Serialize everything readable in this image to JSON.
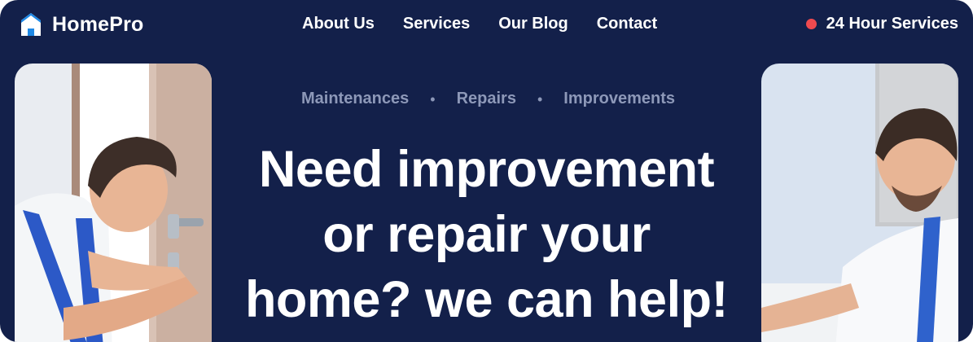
{
  "brand": {
    "name": "HomePro",
    "icon": "house-icon",
    "accent": "#1e88e5"
  },
  "nav": {
    "items": [
      {
        "label": "About Us"
      },
      {
        "label": "Services"
      },
      {
        "label": "Our Blog"
      },
      {
        "label": "Contact"
      }
    ]
  },
  "availability": {
    "label": "24 Hour Services",
    "dot_color": "#ef4a4f"
  },
  "hero": {
    "tags": [
      "Maintenances",
      "Repairs",
      "Improvements"
    ],
    "separator": "•",
    "headline_lines": [
      "Need improvement",
      "or repair your",
      "home? we can help!"
    ]
  },
  "images": {
    "left": "photo of repairman installing a door handle",
    "right": "photo of smiling repairman in overalls"
  },
  "colors": {
    "background": "#13204a",
    "text": "#ffffff",
    "muted": "#8d98b8"
  }
}
